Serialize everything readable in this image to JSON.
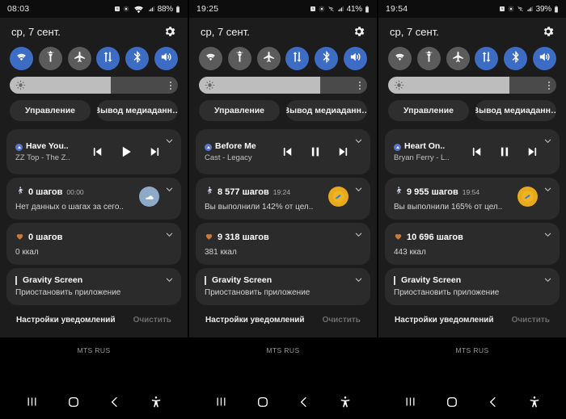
{
  "panels": [
    {
      "status": {
        "time": "08:03",
        "battery": "88%",
        "icons": [
          "alarm-icon",
          "dnd-icon",
          "wifi-icon",
          "signal-icon",
          "battery-icon"
        ]
      },
      "date": "ср, 7 сент.",
      "settings_icon": "gear-icon",
      "toggles": [
        {
          "name": "wifi",
          "icon": "wifi-icon",
          "on": true
        },
        {
          "name": "flashlight",
          "icon": "flashlight-icon",
          "on": false
        },
        {
          "name": "airplane-mode",
          "icon": "airplane-icon",
          "on": false
        },
        {
          "name": "mobile-data",
          "icon": "data-transfer-icon",
          "on": true
        },
        {
          "name": "bluetooth",
          "icon": "bluetooth-icon",
          "on": true
        },
        {
          "name": "sound",
          "icon": "speaker-icon",
          "on": true
        }
      ],
      "brightness": {
        "icon": "brightness-sun-icon",
        "percent": 60,
        "menu_icon": "more-vertical-icon"
      },
      "pills": [
        {
          "name": "device-control",
          "label": "Управление"
        },
        {
          "name": "media-output",
          "label": "Вывод медиаданн…"
        }
      ],
      "media": {
        "app_icon": "media-app-icon",
        "title": "Have You..",
        "subtitle": "ZZ Top - The Z..",
        "prev_icon": "skip-previous-icon",
        "playpause_icon": "play-icon",
        "next_icon": "skip-next-icon",
        "expand_icon": "chevron-down-icon"
      },
      "steps": {
        "icon": "walking-person-icon",
        "count": "0 шагов",
        "time": "00:00",
        "desc": "Нет данных о шагах за сего..",
        "badge": "shoe-icon",
        "badge_style": "blue",
        "expand_icon": "chevron-down-icon"
      },
      "health": {
        "icon": "heart-icon",
        "count": "0 шагов",
        "calories": "0 ккал",
        "expand_icon": "chevron-down-icon"
      },
      "app_notif": {
        "name": "Gravity Screen",
        "desc": "Приостановить приложение",
        "expand_icon": "chevron-down-icon"
      },
      "footer": {
        "settings_label": "Настройки уведомлений",
        "clear_label": "Очистить",
        "clear_disabled": true
      },
      "carrier": "MTS RUS",
      "nav": [
        {
          "name": "recents",
          "icon": "recents-icon"
        },
        {
          "name": "home",
          "icon": "home-icon"
        },
        {
          "name": "back",
          "icon": "back-icon"
        },
        {
          "name": "accessibility",
          "icon": "accessibility-icon"
        }
      ]
    },
    {
      "status": {
        "time": "19:25",
        "battery": "41%",
        "icons": [
          "alarm-icon",
          "dnd-icon",
          "wifi-off-icon",
          "signal-icon",
          "battery-icon"
        ]
      },
      "date": "ср, 7 сент.",
      "settings_icon": "gear-icon",
      "toggles": [
        {
          "name": "wifi",
          "icon": "wifi-icon",
          "on": false
        },
        {
          "name": "flashlight",
          "icon": "flashlight-icon",
          "on": false
        },
        {
          "name": "airplane-mode",
          "icon": "airplane-icon",
          "on": false
        },
        {
          "name": "mobile-data",
          "icon": "data-transfer-icon",
          "on": true
        },
        {
          "name": "bluetooth",
          "icon": "bluetooth-icon",
          "on": true
        },
        {
          "name": "sound",
          "icon": "speaker-icon",
          "on": true
        }
      ],
      "brightness": {
        "icon": "brightness-sun-icon",
        "percent": 72,
        "menu_icon": "more-vertical-icon"
      },
      "pills": [
        {
          "name": "device-control",
          "label": "Управление"
        },
        {
          "name": "media-output",
          "label": "Вывод медиаданн…"
        }
      ],
      "media": {
        "app_icon": "media-app-icon",
        "title": "Before Me",
        "subtitle": "Cast - Legacy",
        "prev_icon": "skip-previous-icon",
        "playpause_icon": "pause-icon",
        "next_icon": "skip-next-icon",
        "expand_icon": "chevron-down-icon"
      },
      "steps": {
        "icon": "walking-person-icon",
        "count": "8 577 шагов",
        "time": "19:24",
        "desc": "Вы выполнили 142% от цел..",
        "badge": "medal-icon",
        "badge_style": "gold",
        "expand_icon": "chevron-down-icon"
      },
      "health": {
        "icon": "heart-icon",
        "count": "9 318 шагов",
        "calories": "381 ккал",
        "expand_icon": "chevron-down-icon"
      },
      "app_notif": {
        "name": "Gravity Screen",
        "desc": "Приостановить приложение",
        "expand_icon": "chevron-down-icon"
      },
      "footer": {
        "settings_label": "Настройки уведомлений",
        "clear_label": "Очистить",
        "clear_disabled": true
      },
      "carrier": "MTS RUS",
      "nav": [
        {
          "name": "recents",
          "icon": "recents-icon"
        },
        {
          "name": "home",
          "icon": "home-icon"
        },
        {
          "name": "back",
          "icon": "back-icon"
        },
        {
          "name": "accessibility",
          "icon": "accessibility-icon"
        }
      ]
    },
    {
      "status": {
        "time": "19:54",
        "battery": "39%",
        "icons": [
          "alarm-icon",
          "dnd-icon",
          "wifi-off-icon",
          "signal-icon",
          "battery-icon"
        ]
      },
      "date": "ср, 7 сент.",
      "settings_icon": "gear-icon",
      "toggles": [
        {
          "name": "wifi",
          "icon": "wifi-icon",
          "on": false
        },
        {
          "name": "flashlight",
          "icon": "flashlight-icon",
          "on": false
        },
        {
          "name": "airplane-mode",
          "icon": "airplane-icon",
          "on": false
        },
        {
          "name": "mobile-data",
          "icon": "data-transfer-icon",
          "on": true
        },
        {
          "name": "bluetooth",
          "icon": "bluetooth-icon",
          "on": true
        },
        {
          "name": "sound",
          "icon": "speaker-icon",
          "on": true
        }
      ],
      "brightness": {
        "icon": "brightness-sun-icon",
        "percent": 72,
        "menu_icon": "more-vertical-icon"
      },
      "pills": [
        {
          "name": "device-control",
          "label": "Управление"
        },
        {
          "name": "media-output",
          "label": "Вывод медиаданн…"
        }
      ],
      "media": {
        "app_icon": "media-app-icon",
        "title": "Heart On..",
        "subtitle": "Bryan Ferry - L..",
        "prev_icon": "skip-previous-icon",
        "playpause_icon": "pause-icon",
        "next_icon": "skip-next-icon",
        "expand_icon": "chevron-down-icon"
      },
      "steps": {
        "icon": "walking-person-icon",
        "count": "9 955 шагов",
        "time": "19:54",
        "desc": "Вы выполнили 165% от цел..",
        "badge": "medal-icon",
        "badge_style": "gold",
        "expand_icon": "chevron-down-icon"
      },
      "health": {
        "icon": "heart-icon",
        "count": "10 696 шагов",
        "calories": "443 ккал",
        "expand_icon": "chevron-down-icon"
      },
      "app_notif": {
        "name": "Gravity Screen",
        "desc": "Приостановить приложение",
        "expand_icon": "chevron-down-icon"
      },
      "footer": {
        "settings_label": "Настройки уведомлений",
        "clear_label": "Очистить",
        "clear_disabled": true
      },
      "carrier": "MTS RUS",
      "nav": [
        {
          "name": "recents",
          "icon": "recents-icon"
        },
        {
          "name": "home",
          "icon": "home-icon"
        },
        {
          "name": "back",
          "icon": "back-icon"
        },
        {
          "name": "accessibility",
          "icon": "accessibility-icon"
        }
      ]
    }
  ],
  "colors": {
    "accent_on": "#3d6cc4",
    "toggle_off": "#5b5b5b",
    "shade_bg": "#1c1c1c",
    "card_bg": "#2b2b2b",
    "badge_gold": "#e8a91d",
    "badge_blue": "#8faac9"
  }
}
